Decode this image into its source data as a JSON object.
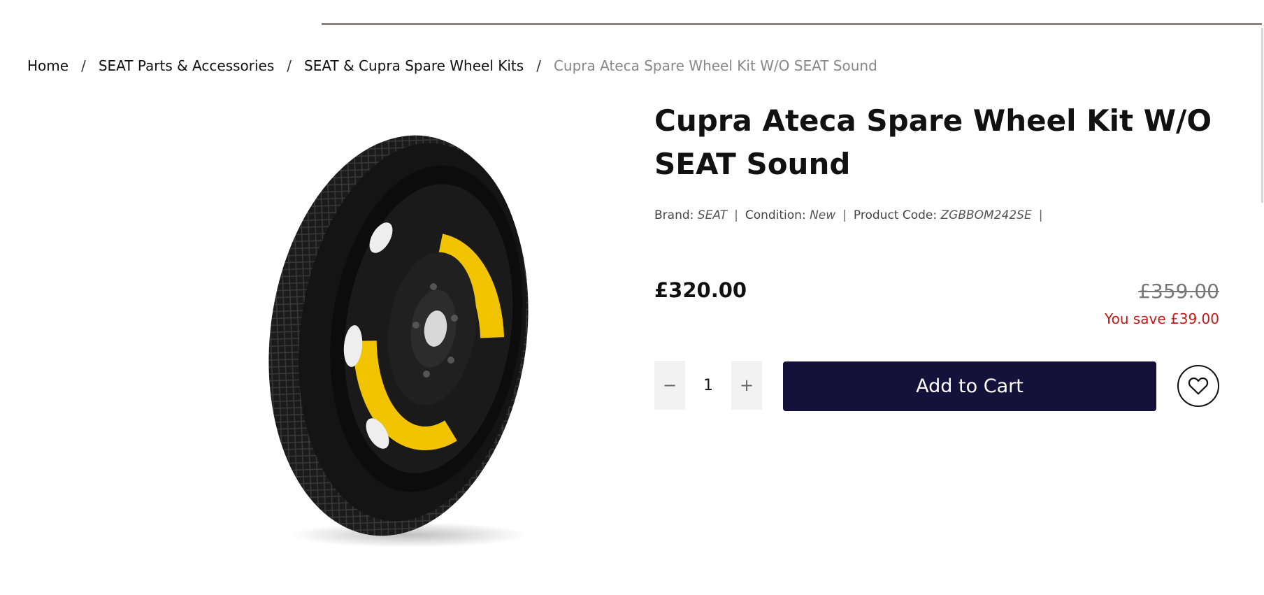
{
  "breadcrumb": {
    "items": [
      "Home",
      "SEAT Parts & Accessories",
      "SEAT & Cupra Spare Wheel Kits"
    ],
    "current": "Cupra Ateca Spare Wheel Kit W/O SEAT Sound",
    "separator": "/"
  },
  "product": {
    "title": "Cupra Ateca Spare Wheel Kit W/O SEAT Sound",
    "image_icon": "spare-wheel-image",
    "meta": {
      "brand_label": "Brand:",
      "brand": "SEAT",
      "condition_label": "Condition:",
      "condition": "New",
      "code_label": "Product Code:",
      "code": "ZGBBOM242SE",
      "separator": "|"
    },
    "price": "£320.00",
    "old_price": "£359.00",
    "save_text": "You save £39.00",
    "quantity": "1",
    "minus_label": "−",
    "plus_label": "+",
    "add_to_cart_label": "Add to Cart",
    "wishlist_icon": "heart-icon"
  },
  "colors": {
    "accent": "#14123a",
    "save": "#c21818",
    "wheel_yellow": "#f2c400"
  }
}
